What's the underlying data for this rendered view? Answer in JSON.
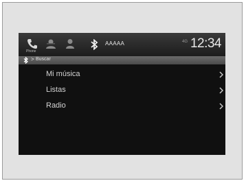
{
  "status_bar": {
    "phone_label": "Phone",
    "device_name": "AAAAA",
    "signal_text": "4G",
    "time": "12:34"
  },
  "breadcrumb": {
    "separator": ">",
    "current": "Buscar"
  },
  "menu": {
    "items": [
      {
        "label": "Mi música"
      },
      {
        "label": "Listas"
      },
      {
        "label": "Radio"
      }
    ]
  }
}
